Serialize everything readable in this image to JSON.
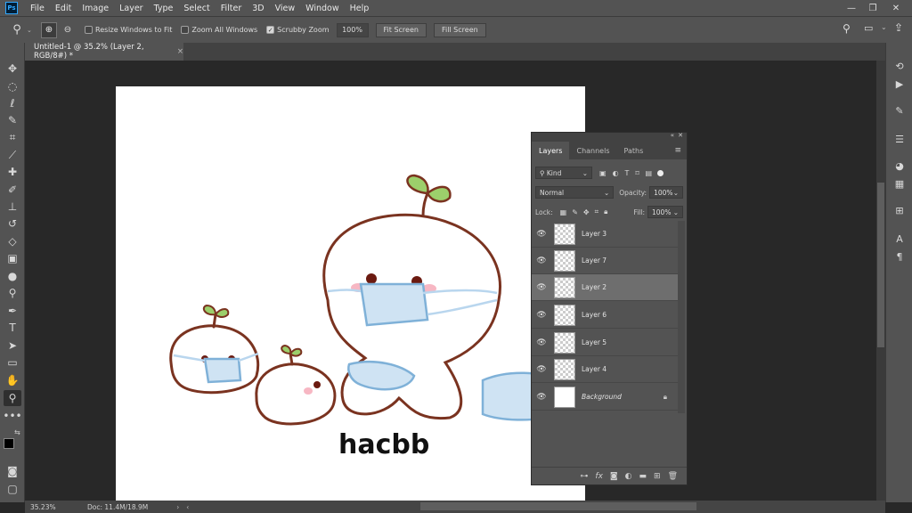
{
  "app": {
    "logo": "Ps"
  },
  "menu": [
    "File",
    "Edit",
    "Image",
    "Layer",
    "Type",
    "Select",
    "Filter",
    "3D",
    "View",
    "Window",
    "Help"
  ],
  "options": {
    "resize_windows": "Resize Windows to Fit",
    "zoom_all": "Zoom All Windows",
    "scrubby": "Scrubby Zoom",
    "zoom_value": "100%",
    "fit_screen": "Fit Screen",
    "fill_screen": "Fill Screen",
    "resize_checked": false,
    "zoom_all_checked": false,
    "scrubby_checked": true
  },
  "document": {
    "tab_title": "Untitled-1 @ 35.2% (Layer 2, RGB/8#) *",
    "close": "×"
  },
  "layers_panel": {
    "tabs": [
      "Layers",
      "Channels",
      "Paths"
    ],
    "filter_kind": "Kind",
    "blend_mode": "Normal",
    "opacity_label": "Opacity:",
    "opacity_value": "100%",
    "lock_label": "Lock:",
    "fill_label": "Fill:",
    "fill_value": "100%",
    "layers": [
      {
        "name": "Layer 3",
        "selected": false
      },
      {
        "name": "Layer 7",
        "selected": false
      },
      {
        "name": "Layer 2",
        "selected": true
      },
      {
        "name": "Layer 6",
        "selected": false
      },
      {
        "name": "Layer 5",
        "selected": false
      },
      {
        "name": "Layer 4",
        "selected": false
      },
      {
        "name": "Background",
        "selected": false
      }
    ]
  },
  "canvas": {
    "signature": "hacbb"
  },
  "status": {
    "zoom": "35.23%",
    "doc": "Doc: 11.4M/18.9M"
  }
}
